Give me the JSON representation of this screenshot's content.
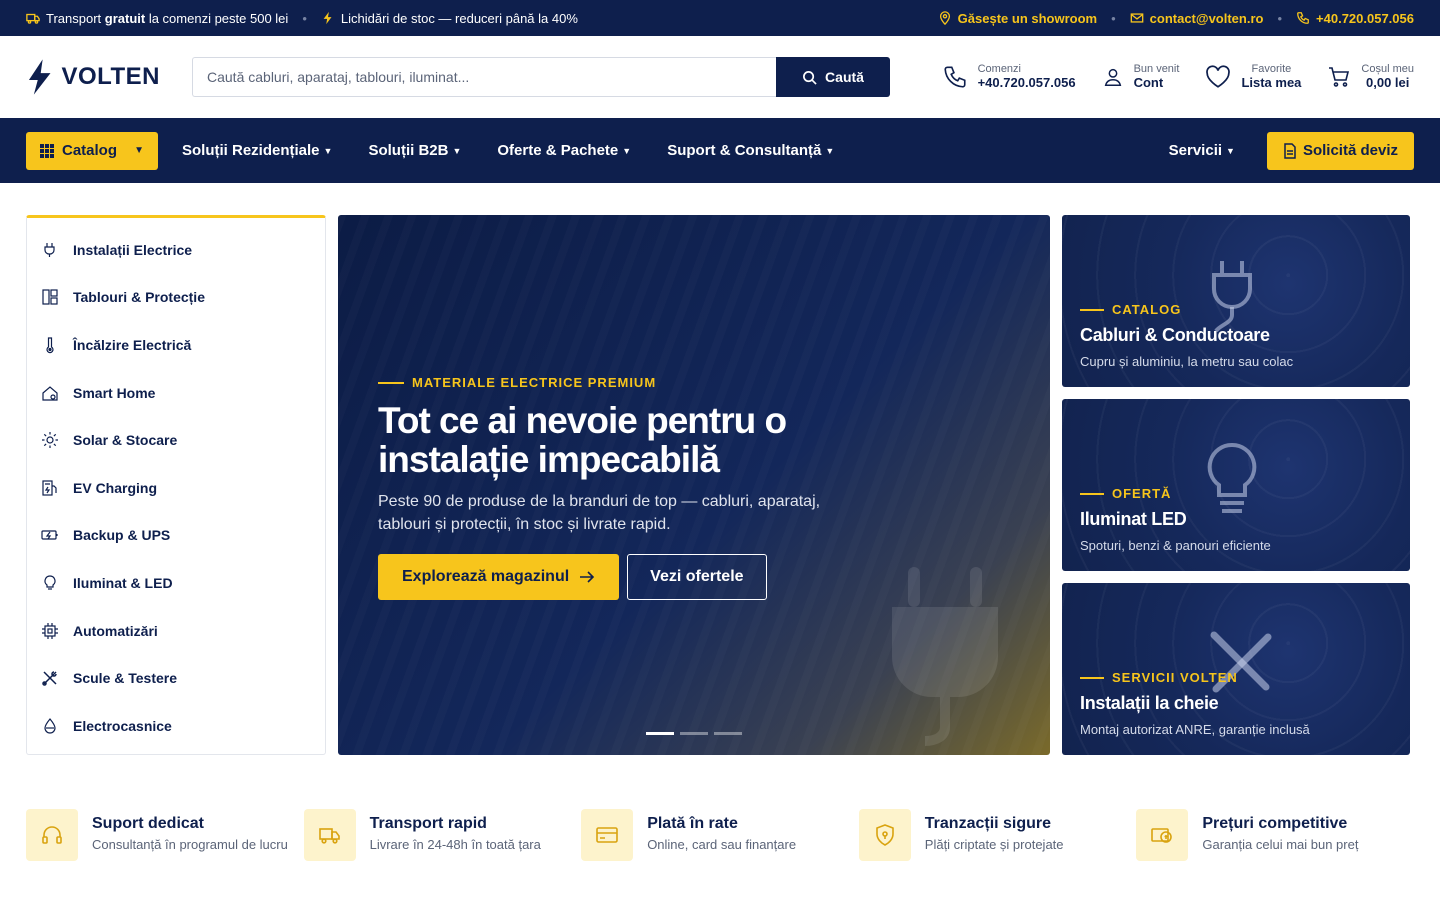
{
  "topbar": {
    "promo1_pre": "Transport ",
    "promo1_bold": "gratuit",
    "promo1_post": " la comenzi peste 500 lei",
    "promo2": "Lichidări de stoc — reduceri până la 40%",
    "showroom": "Găsește un showroom",
    "email": "contact@volten.ro",
    "phone": "+40.720.057.056"
  },
  "header": {
    "logo": "VOLTEN",
    "search_placeholder": "Caută cabluri, aparataj, tablouri, iluminat...",
    "search_button": "Caută",
    "orders_small": "Comenzi",
    "orders_big": "+40.720.057.056",
    "account_small": "Bun venit",
    "account_big": "Cont",
    "fav_small": "Favorite",
    "fav_big": "Lista mea",
    "cart_small": "Coșul meu",
    "cart_big": "0,00 lei"
  },
  "nav": {
    "catalog": "Catalog",
    "links": [
      "Soluții Rezidențiale",
      "Soluții B2B",
      "Oferte & Pachete",
      "Suport & Consultanță"
    ],
    "servicii": "Servicii",
    "deviz": "Solicită deviz"
  },
  "sidebar": {
    "items": [
      {
        "label": "Instalații Electrice",
        "icon": "plug-icon"
      },
      {
        "label": "Tablouri & Protecție",
        "icon": "panel-icon"
      },
      {
        "label": "Încălzire Electrică",
        "icon": "thermometer-icon"
      },
      {
        "label": "Smart Home",
        "icon": "smart-home-icon"
      },
      {
        "label": "Solar & Stocare",
        "icon": "sun-icon"
      },
      {
        "label": "EV Charging",
        "icon": "ev-charger-icon"
      },
      {
        "label": "Backup & UPS",
        "icon": "battery-icon"
      },
      {
        "label": "Iluminat & LED",
        "icon": "bulb-icon"
      },
      {
        "label": "Automatizări",
        "icon": "chip-icon"
      },
      {
        "label": "Scule & Testere",
        "icon": "tools-icon"
      },
      {
        "label": "Electrocasnice",
        "icon": "drop-icon"
      }
    ]
  },
  "hero": {
    "eyebrow": "MATERIALE ELECTRICE PREMIUM",
    "title": "Tot ce ai nevoie pentru o instalație impecabilă",
    "text": "Peste 90 de produse de la branduri de top — cabluri, aparataj, tablouri și protecții, în stoc și livrate rapid.",
    "cta_primary": "Explorează magazinul",
    "cta_secondary": "Vezi ofertele"
  },
  "promos": [
    {
      "eyebrow": "CATALOG",
      "title": "Cabluri & Conductoare",
      "sub": "Cupru și aluminiu, la metru sau colac",
      "icon": "plug-icon"
    },
    {
      "eyebrow": "OFERTĂ",
      "title": "Iluminat LED",
      "sub": "Spoturi, benzi & panouri eficiente",
      "icon": "bulb-icon"
    },
    {
      "eyebrow": "SERVICII VOLTEN",
      "title": "Instalații la cheie",
      "sub": "Montaj autorizat ANRE, garanție inclusă",
      "icon": "tools-icon"
    }
  ],
  "features": [
    {
      "title": "Suport dedicat",
      "sub": "Consultanță în programul de lucru",
      "icon": "headset-icon"
    },
    {
      "title": "Transport rapid",
      "sub": "Livrare în 24-48h în toată țara",
      "icon": "truck-icon"
    },
    {
      "title": "Plată în rate",
      "sub": "Online, card sau finanțare",
      "icon": "card-icon"
    },
    {
      "title": "Tranzacții sigure",
      "sub": "Plăți criptate și protejate",
      "icon": "shield-icon"
    },
    {
      "title": "Prețuri competitive",
      "sub": "Garanția celui mai bun preț",
      "icon": "price-icon"
    }
  ],
  "colors": {
    "navy": "#0e1f4d",
    "accent": "#f7c51c"
  }
}
